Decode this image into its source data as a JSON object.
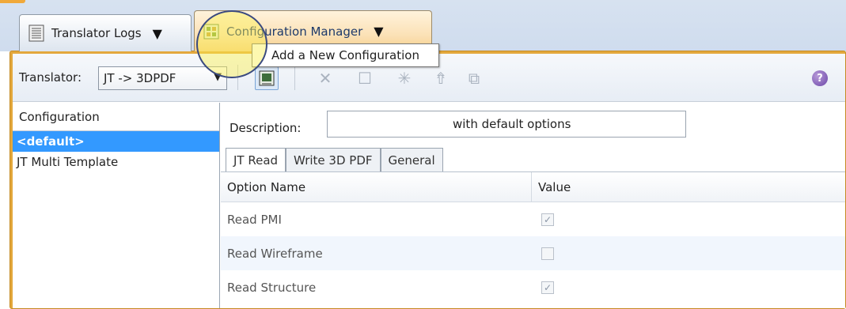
{
  "tabs": [
    {
      "label": "Translator Logs",
      "icon": "log-list-icon",
      "arrow": "▼"
    },
    {
      "label": "Configuration Manager",
      "icon": "config-manager-icon",
      "arrow": "▼"
    }
  ],
  "toolbar": {
    "translator_label": "Translator:",
    "translator_value": "JT -> 3DPDF",
    "buttons": [
      {
        "name": "add-configuration-icon",
        "glyph": "▣"
      },
      {
        "name": "delete-icon",
        "glyph": "✕"
      },
      {
        "name": "blank-config-icon",
        "glyph": "☐"
      },
      {
        "name": "asterisk-icon",
        "glyph": "✳"
      },
      {
        "name": "upload-icon",
        "glyph": "⇮"
      },
      {
        "name": "copy-icon",
        "glyph": "⧉"
      }
    ],
    "help_glyph": "?"
  },
  "tooltip": "Add a New Configuration",
  "configurations": {
    "header": "Configuration",
    "items": [
      "<default>",
      "JT Multi Template"
    ]
  },
  "details": {
    "description_label": "Description:",
    "description_value": "with default options",
    "subtabs": [
      "JT Read",
      "Write 3D PDF",
      "General"
    ],
    "columns": [
      "Option Name",
      "Value"
    ],
    "rows": [
      {
        "name": "Read PMI",
        "checked": true
      },
      {
        "name": "Read Wireframe",
        "checked": false
      },
      {
        "name": "Read Structure",
        "checked": true
      }
    ]
  },
  "colors": {
    "accent": "#3399ff",
    "panel_border": "#e3a83c"
  }
}
